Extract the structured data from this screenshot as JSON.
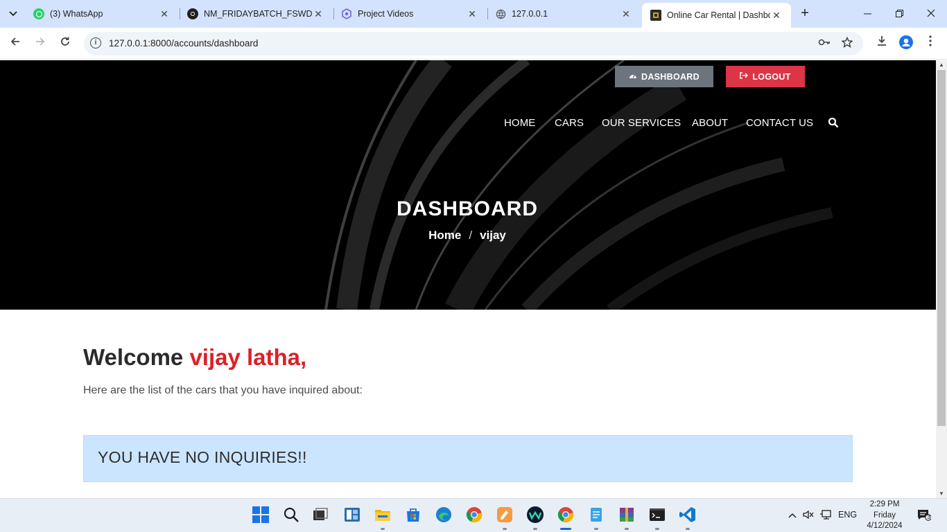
{
  "browser": {
    "tabs": [
      {
        "title": "(3) WhatsApp",
        "icon": "whatsapp-icon",
        "active": false
      },
      {
        "title": "NM_FRIDAYBATCH_FSWD_P",
        "icon": "github-icon",
        "active": false
      },
      {
        "title": "Project Videos",
        "icon": "project-icon",
        "active": false
      },
      {
        "title": "127.0.0.1",
        "icon": "globe-icon",
        "active": false
      },
      {
        "title": "Online Car Rental | Dashboa",
        "icon": "site-logo-icon",
        "active": true
      }
    ],
    "url": "127.0.0.1:8000/accounts/dashboard"
  },
  "page": {
    "top_buttons": {
      "dashboard": "DASHBOARD",
      "logout": "LOGOUT"
    },
    "nav": [
      "HOME",
      "CARS",
      "OUR SERVICES",
      "ABOUT",
      "CONTACT US"
    ],
    "hero_title": "DASHBOARD",
    "breadcrumb": {
      "home": "Home",
      "sep": "/",
      "current": "vijay"
    },
    "welcome": {
      "prefix": "Welcome ",
      "name": "vijay latha,"
    },
    "subtitle": "Here are the list of the cars that you have inquired about:",
    "alert": "YOU HAVE NO INQUIRIES!!",
    "colors": {
      "accent_red": "#dc2027",
      "logout_red": "#dc3545",
      "dashboard_gray": "#6c757d",
      "alert_bg": "#cce5ff"
    }
  },
  "taskbar": {
    "lang": "ENG",
    "time": "2:29 PM",
    "day": "Friday",
    "date": "4/12/2024",
    "notifications": "3"
  }
}
